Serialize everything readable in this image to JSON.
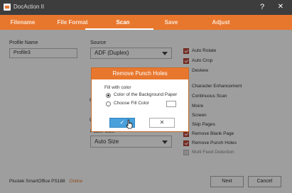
{
  "window": {
    "title": "DocAction II",
    "help_label": "?",
    "close_label": "✕"
  },
  "tabs": [
    {
      "label": "Filename"
    },
    {
      "label": "File Format"
    },
    {
      "label": "Scan"
    },
    {
      "label": "Save"
    },
    {
      "label": "Adjust"
    }
  ],
  "form": {
    "profile_name_label": "Profile Name",
    "profile_name_value": "Profile3",
    "source_label": "Source",
    "source_value": "ADF (Duplex)",
    "hidden_label_c1": "C",
    "hidden_label_c2": "C",
    "paper_size_label_partial": "Paper Size",
    "paper_size_value": "Auto Size"
  },
  "options": [
    {
      "label": "Auto Rotate",
      "checked": true,
      "disabled": false
    },
    {
      "label": "Auto Crop",
      "checked": true,
      "disabled": false
    },
    {
      "label": "Deskew",
      "checked": false,
      "disabled": false
    },
    {
      "label": "Character Enhancement",
      "checked": false,
      "disabled": false
    },
    {
      "label": "Continuous Scan",
      "checked": false,
      "disabled": false
    },
    {
      "label": "Moire",
      "checked": false,
      "disabled": false
    },
    {
      "label": "Screen",
      "checked": false,
      "disabled": false
    },
    {
      "label": "Skip Pages",
      "checked": false,
      "disabled": false
    },
    {
      "label": "Remove Blank Page",
      "checked": true,
      "disabled": false
    },
    {
      "label": "Remove Punch Holes",
      "checked": true,
      "disabled": false
    },
    {
      "label": "Multi Feed Detection",
      "checked": false,
      "disabled": true
    }
  ],
  "footer": {
    "device_name": "Plustek SmartOffice PS188",
    "device_status": "Online",
    "next_label": "Next",
    "cancel_label": "Cancel"
  },
  "dialog": {
    "title": "Remove Punch Holes",
    "group_label": "Fill with color",
    "option_background": "Color of the Background Paper",
    "option_fill": "Choose Fill Color",
    "ok_icon": "checkmark-icon",
    "cancel_icon": "close-icon",
    "ok_symbol": "✓",
    "cancel_symbol": "✕",
    "selected_option": "Color of the Background Paper"
  },
  "colors": {
    "accent": "#e8772e",
    "titlebar": "#3d3d3d",
    "checkbox": "#c84a3a",
    "ok_button": "#4aa0db"
  }
}
